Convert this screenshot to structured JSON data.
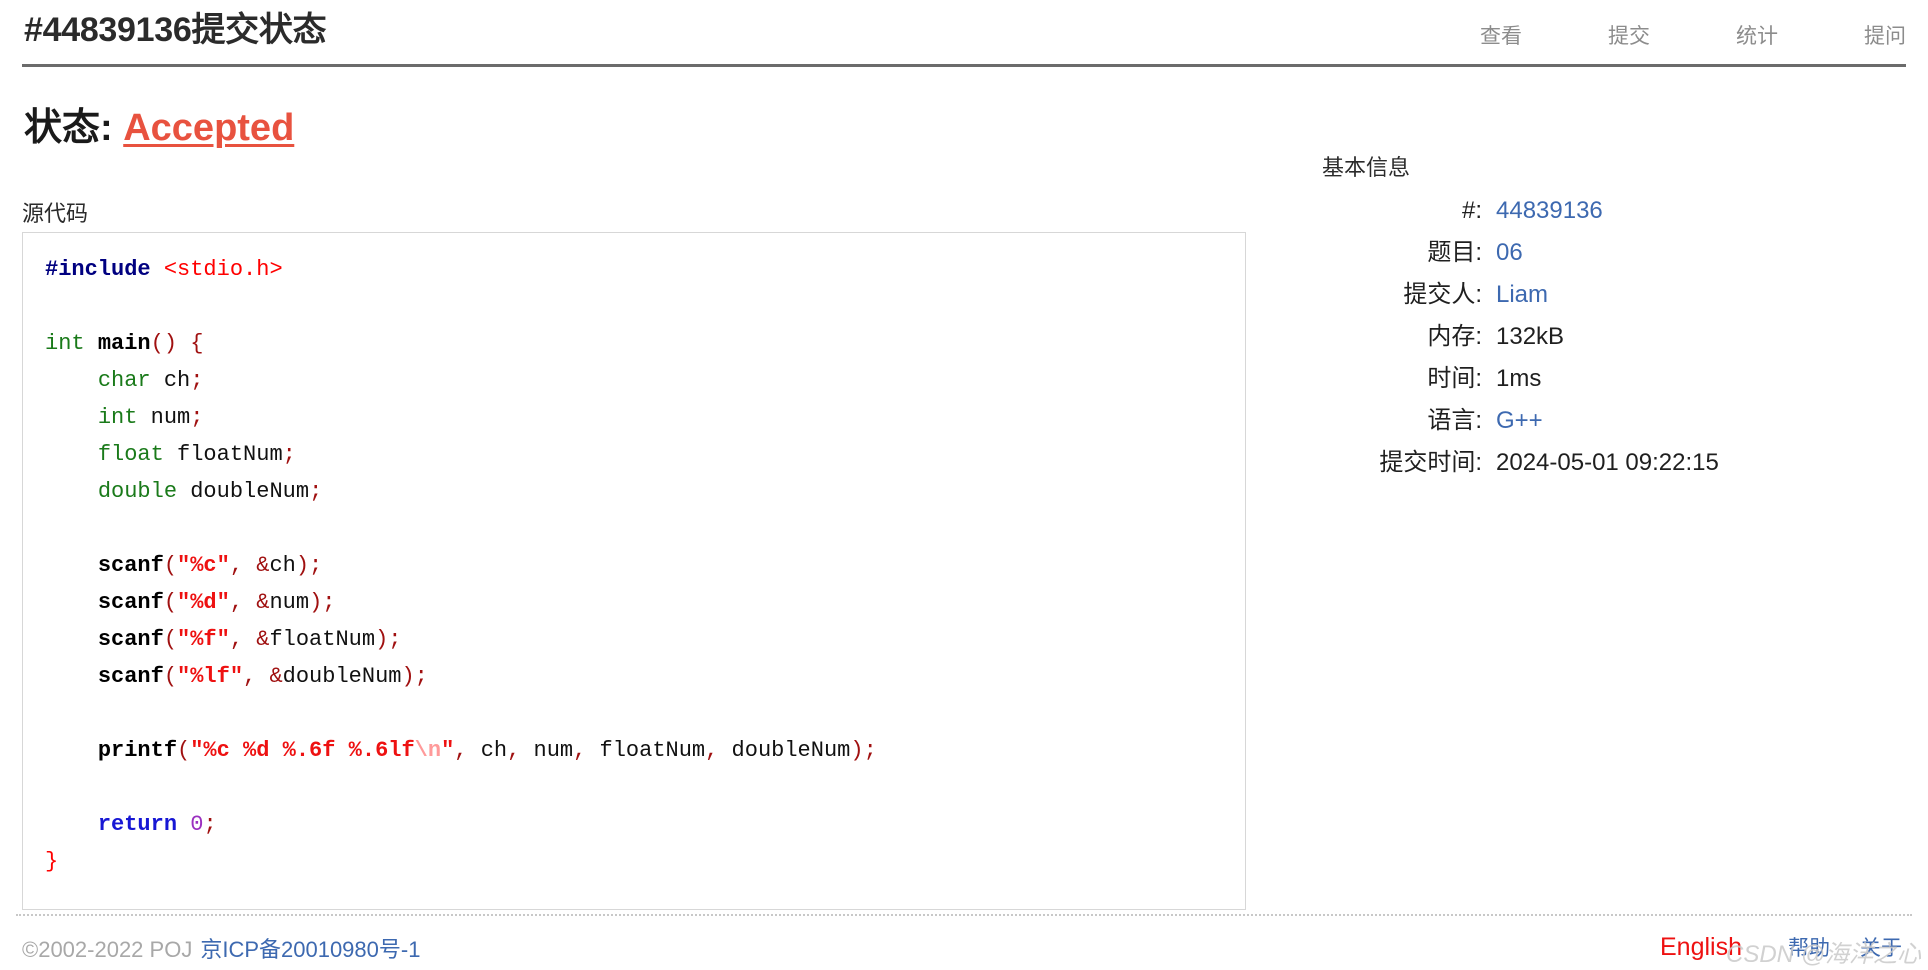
{
  "header": {
    "title": "#44839136提交状态",
    "nav": [
      {
        "label": "查看"
      },
      {
        "label": "提交"
      },
      {
        "label": "统计"
      },
      {
        "label": "提问"
      }
    ]
  },
  "status": {
    "label": "状态:",
    "value": "Accepted",
    "accent_color": "#e8523f"
  },
  "source": {
    "label": "源代码",
    "language": "c",
    "lines": [
      "#include <stdio.h>",
      "",
      "int main() {",
      "    char ch;",
      "    int num;",
      "    float floatNum;",
      "    double doubleNum;",
      "",
      "    scanf(\"%c\", &ch);",
      "    scanf(\"%d\", &num);",
      "    scanf(\"%f\", &floatNum);",
      "    scanf(\"%lf\", &doubleNum);",
      "",
      "    printf(\"%c %d %.6f %.6lf\\n\", ch, num, floatNum, doubleNum);",
      "",
      "    return 0;",
      "}"
    ]
  },
  "info": {
    "title": "基本信息",
    "rows": [
      {
        "key": "#:",
        "value": "44839136",
        "is_link": true
      },
      {
        "key": "题目:",
        "value": "06",
        "is_link": true
      },
      {
        "key": "提交人:",
        "value": "Liam",
        "is_link": true
      },
      {
        "key": "内存:",
        "value": "132kB",
        "is_link": false
      },
      {
        "key": "时间:",
        "value": "1ms",
        "is_link": false
      },
      {
        "key": "语言:",
        "value": "G++",
        "is_link": true
      },
      {
        "key": "提交时间:",
        "value": "2024-05-01 09:22:15",
        "is_link": false
      }
    ]
  },
  "footer": {
    "copyright": "©2002-2022 POJ",
    "icp": "京ICP备20010980号-1",
    "language_toggle": "English",
    "links": [
      {
        "label": "帮助"
      },
      {
        "label": "关于"
      }
    ]
  },
  "watermark": {
    "text": "CSDN @海洋之心"
  }
}
